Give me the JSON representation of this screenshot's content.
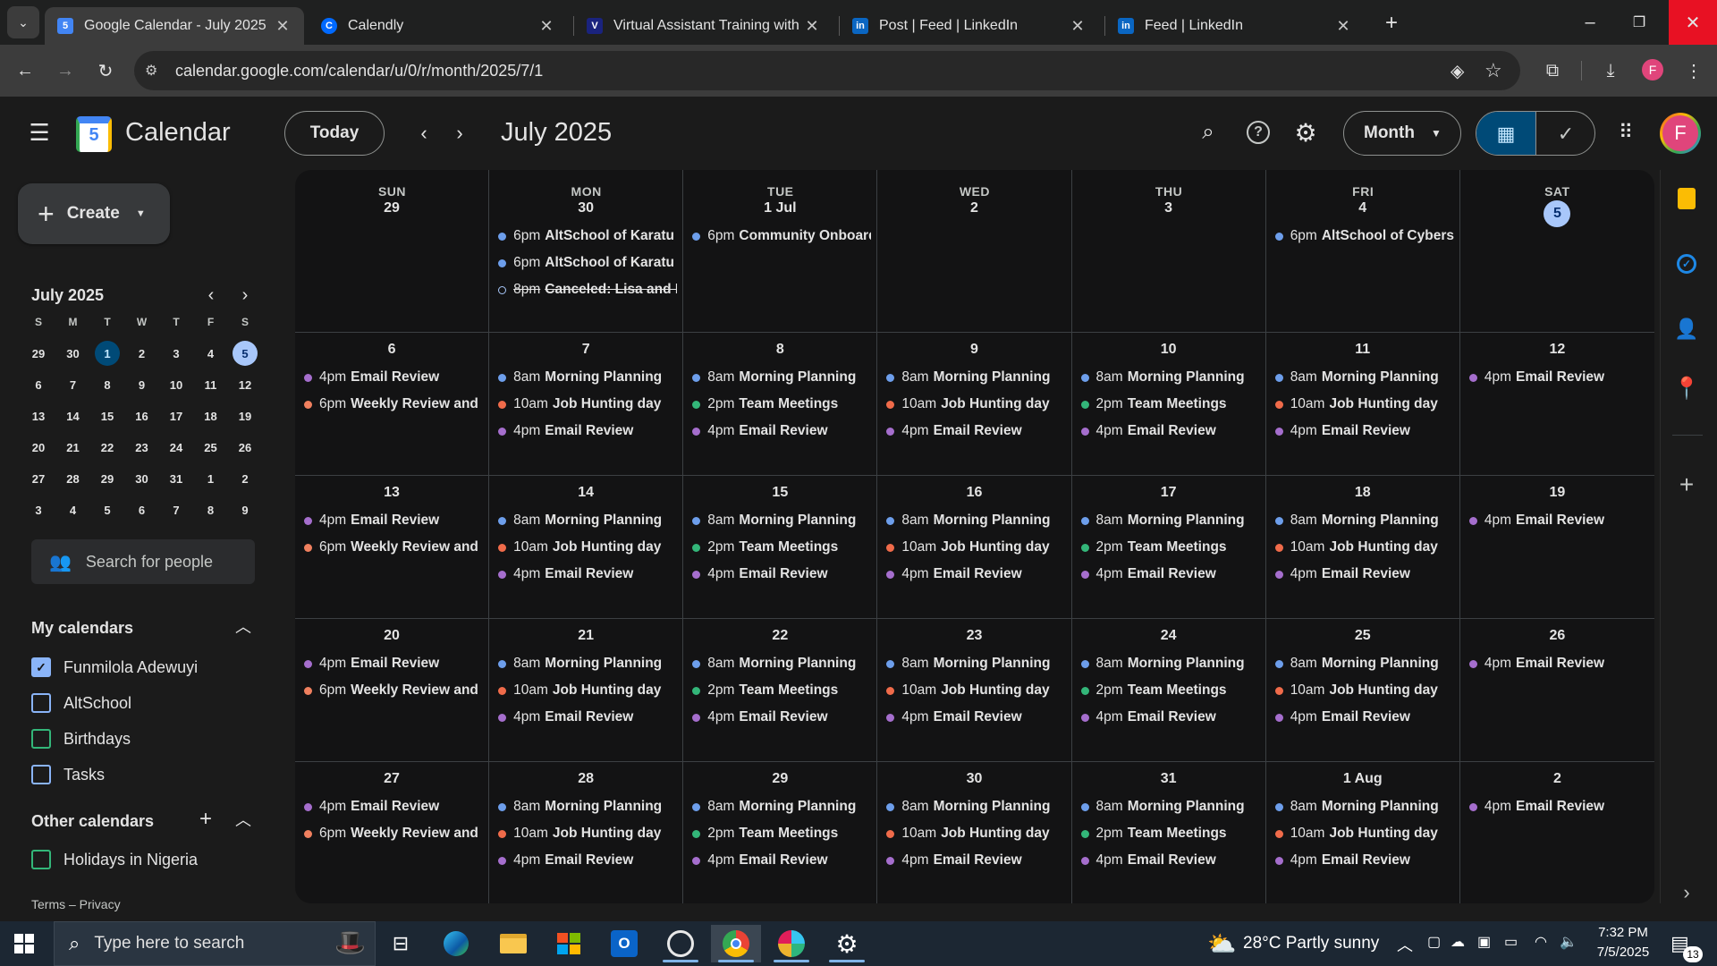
{
  "browser": {
    "tabs": [
      {
        "title": "Google Calendar - July 2025",
        "active": true
      },
      {
        "title": "Calendly",
        "active": false
      },
      {
        "title": "Virtual Assistant Training with V",
        "active": false
      },
      {
        "title": "Post | Feed | LinkedIn",
        "active": false
      },
      {
        "title": "Feed | LinkedIn",
        "active": false
      }
    ],
    "url": "calendar.google.com/calendar/u/0/r/month/2025/7/1",
    "profile_initial": "F"
  },
  "app": {
    "name": "Calendar",
    "logo_day": "5",
    "today_label": "Today",
    "title": "July 2025",
    "view_label": "Month",
    "avatar_initial": "F"
  },
  "sidebar": {
    "create_label": "Create",
    "mini": {
      "title": "July 2025",
      "weekdays": [
        "S",
        "M",
        "T",
        "W",
        "T",
        "F",
        "S"
      ],
      "weeks": [
        [
          "29",
          "30",
          "1",
          "2",
          "3",
          "4",
          "5"
        ],
        [
          "6",
          "7",
          "8",
          "9",
          "10",
          "11",
          "12"
        ],
        [
          "13",
          "14",
          "15",
          "16",
          "17",
          "18",
          "19"
        ],
        [
          "20",
          "21",
          "22",
          "23",
          "24",
          "25",
          "26"
        ],
        [
          "27",
          "28",
          "29",
          "30",
          "31",
          "1",
          "2"
        ],
        [
          "3",
          "4",
          "5",
          "6",
          "7",
          "8",
          "9"
        ]
      ]
    },
    "search_people": "Search for people",
    "my_calendars_title": "My calendars",
    "my_calendars": [
      {
        "label": "Funmilola Adewuyi",
        "checked": true
      },
      {
        "label": "AltSchool",
        "checked": false
      },
      {
        "label": "Birthdays",
        "checked": false
      },
      {
        "label": "Tasks",
        "checked": false
      }
    ],
    "other_calendars_title": "Other calendars",
    "other_calendars": [
      {
        "label": "Holidays in Nigeria",
        "checked": false
      }
    ],
    "footer": "Terms – Privacy"
  },
  "colors": {
    "purple": "#a56ecd",
    "orange": "#f0805f",
    "blue": "#6d9eeb",
    "green": "#33b679",
    "red": "#f06b4a",
    "teal": "#4db6ac"
  },
  "grid": {
    "weekdays": [
      "SUN",
      "MON",
      "TUE",
      "WED",
      "THU",
      "FRI",
      "SAT"
    ],
    "weeks": [
      [
        {
          "day": "29",
          "events": []
        },
        {
          "day": "30",
          "events": [
            {
              "time": "6pm",
              "title": "AltSchool of Karatu",
              "color": "blue"
            },
            {
              "time": "6pm",
              "title": "AltSchool of Karatu",
              "color": "blue"
            },
            {
              "time": "8pm",
              "title": "Canceled: Lisa and Fi",
              "color": "hollow",
              "struck": true
            }
          ]
        },
        {
          "day": "1 Jul",
          "events": [
            {
              "time": "6pm",
              "title": "Community Onboard",
              "color": "blue"
            }
          ]
        },
        {
          "day": "2",
          "events": []
        },
        {
          "day": "3",
          "events": []
        },
        {
          "day": "4",
          "events": [
            {
              "time": "6pm",
              "title": "AltSchool of Cybers",
              "color": "blue"
            }
          ]
        },
        {
          "day": "5",
          "today": true,
          "events": []
        }
      ],
      [
        {
          "day": "6",
          "events": [
            {
              "time": "4pm",
              "title": "Email Review",
              "color": "purple"
            },
            {
              "time": "6pm",
              "title": "Weekly Review and P",
              "color": "orange"
            }
          ]
        },
        {
          "day": "7",
          "events": [
            {
              "time": "8am",
              "title": "Morning Planning",
              "color": "blue"
            },
            {
              "time": "10am",
              "title": "Job Hunting day",
              "color": "red"
            },
            {
              "time": "4pm",
              "title": "Email Review",
              "color": "purple"
            }
          ]
        },
        {
          "day": "8",
          "events": [
            {
              "time": "8am",
              "title": "Morning Planning",
              "color": "blue"
            },
            {
              "time": "2pm",
              "title": "Team Meetings",
              "color": "green"
            },
            {
              "time": "4pm",
              "title": "Email Review",
              "color": "purple"
            }
          ]
        },
        {
          "day": "9",
          "events": [
            {
              "time": "8am",
              "title": "Morning Planning",
              "color": "blue"
            },
            {
              "time": "10am",
              "title": "Job Hunting day",
              "color": "red"
            },
            {
              "time": "4pm",
              "title": "Email Review",
              "color": "purple"
            }
          ]
        },
        {
          "day": "10",
          "events": [
            {
              "time": "8am",
              "title": "Morning Planning",
              "color": "blue"
            },
            {
              "time": "2pm",
              "title": "Team Meetings",
              "color": "green"
            },
            {
              "time": "4pm",
              "title": "Email Review",
              "color": "purple"
            }
          ]
        },
        {
          "day": "11",
          "events": [
            {
              "time": "8am",
              "title": "Morning Planning",
              "color": "blue"
            },
            {
              "time": "10am",
              "title": "Job Hunting day",
              "color": "red"
            },
            {
              "time": "4pm",
              "title": "Email Review",
              "color": "purple"
            }
          ]
        },
        {
          "day": "12",
          "events": [
            {
              "time": "4pm",
              "title": "Email Review",
              "color": "purple"
            }
          ]
        }
      ],
      [
        {
          "day": "13",
          "events": [
            {
              "time": "4pm",
              "title": "Email Review",
              "color": "purple"
            },
            {
              "time": "6pm",
              "title": "Weekly Review and P",
              "color": "orange"
            }
          ]
        },
        {
          "day": "14",
          "events": [
            {
              "time": "8am",
              "title": "Morning Planning",
              "color": "blue"
            },
            {
              "time": "10am",
              "title": "Job Hunting day",
              "color": "red"
            },
            {
              "time": "4pm",
              "title": "Email Review",
              "color": "purple"
            }
          ]
        },
        {
          "day": "15",
          "events": [
            {
              "time": "8am",
              "title": "Morning Planning",
              "color": "blue"
            },
            {
              "time": "2pm",
              "title": "Team Meetings",
              "color": "green"
            },
            {
              "time": "4pm",
              "title": "Email Review",
              "color": "purple"
            }
          ]
        },
        {
          "day": "16",
          "events": [
            {
              "time": "8am",
              "title": "Morning Planning",
              "color": "blue"
            },
            {
              "time": "10am",
              "title": "Job Hunting day",
              "color": "red"
            },
            {
              "time": "4pm",
              "title": "Email Review",
              "color": "purple"
            }
          ]
        },
        {
          "day": "17",
          "events": [
            {
              "time": "8am",
              "title": "Morning Planning",
              "color": "blue"
            },
            {
              "time": "2pm",
              "title": "Team Meetings",
              "color": "green"
            },
            {
              "time": "4pm",
              "title": "Email Review",
              "color": "purple"
            }
          ]
        },
        {
          "day": "18",
          "events": [
            {
              "time": "8am",
              "title": "Morning Planning",
              "color": "blue"
            },
            {
              "time": "10am",
              "title": "Job Hunting day",
              "color": "red"
            },
            {
              "time": "4pm",
              "title": "Email Review",
              "color": "purple"
            }
          ]
        },
        {
          "day": "19",
          "events": [
            {
              "time": "4pm",
              "title": "Email Review",
              "color": "purple"
            }
          ]
        }
      ],
      [
        {
          "day": "20",
          "events": [
            {
              "time": "4pm",
              "title": "Email Review",
              "color": "purple"
            },
            {
              "time": "6pm",
              "title": "Weekly Review and P",
              "color": "orange"
            }
          ]
        },
        {
          "day": "21",
          "events": [
            {
              "time": "8am",
              "title": "Morning Planning",
              "color": "blue"
            },
            {
              "time": "10am",
              "title": "Job Hunting day",
              "color": "red"
            },
            {
              "time": "4pm",
              "title": "Email Review",
              "color": "purple"
            }
          ]
        },
        {
          "day": "22",
          "events": [
            {
              "time": "8am",
              "title": "Morning Planning",
              "color": "blue"
            },
            {
              "time": "2pm",
              "title": "Team Meetings",
              "color": "green"
            },
            {
              "time": "4pm",
              "title": "Email Review",
              "color": "purple"
            }
          ]
        },
        {
          "day": "23",
          "events": [
            {
              "time": "8am",
              "title": "Morning Planning",
              "color": "blue"
            },
            {
              "time": "10am",
              "title": "Job Hunting day",
              "color": "red"
            },
            {
              "time": "4pm",
              "title": "Email Review",
              "color": "purple"
            }
          ]
        },
        {
          "day": "24",
          "events": [
            {
              "time": "8am",
              "title": "Morning Planning",
              "color": "blue"
            },
            {
              "time": "2pm",
              "title": "Team Meetings",
              "color": "green"
            },
            {
              "time": "4pm",
              "title": "Email Review",
              "color": "purple"
            }
          ]
        },
        {
          "day": "25",
          "events": [
            {
              "time": "8am",
              "title": "Morning Planning",
              "color": "blue"
            },
            {
              "time": "10am",
              "title": "Job Hunting day",
              "color": "red"
            },
            {
              "time": "4pm",
              "title": "Email Review",
              "color": "purple"
            }
          ]
        },
        {
          "day": "26",
          "events": [
            {
              "time": "4pm",
              "title": "Email Review",
              "color": "purple"
            }
          ]
        }
      ],
      [
        {
          "day": "27",
          "events": [
            {
              "time": "4pm",
              "title": "Email Review",
              "color": "purple"
            },
            {
              "time": "6pm",
              "title": "Weekly Review and P",
              "color": "orange"
            }
          ]
        },
        {
          "day": "28",
          "events": [
            {
              "time": "8am",
              "title": "Morning Planning",
              "color": "blue"
            },
            {
              "time": "10am",
              "title": "Job Hunting day",
              "color": "red"
            },
            {
              "time": "4pm",
              "title": "Email Review",
              "color": "purple"
            }
          ]
        },
        {
          "day": "29",
          "events": [
            {
              "time": "8am",
              "title": "Morning Planning",
              "color": "blue"
            },
            {
              "time": "2pm",
              "title": "Team Meetings",
              "color": "green"
            },
            {
              "time": "4pm",
              "title": "Email Review",
              "color": "purple"
            }
          ]
        },
        {
          "day": "30",
          "events": [
            {
              "time": "8am",
              "title": "Morning Planning",
              "color": "blue"
            },
            {
              "time": "10am",
              "title": "Job Hunting day",
              "color": "red"
            },
            {
              "time": "4pm",
              "title": "Email Review",
              "color": "purple"
            }
          ]
        },
        {
          "day": "31",
          "events": [
            {
              "time": "8am",
              "title": "Morning Planning",
              "color": "blue"
            },
            {
              "time": "2pm",
              "title": "Team Meetings",
              "color": "green"
            },
            {
              "time": "4pm",
              "title": "Email Review",
              "color": "purple"
            }
          ]
        },
        {
          "day": "1 Aug",
          "events": [
            {
              "time": "8am",
              "title": "Morning Planning",
              "color": "blue"
            },
            {
              "time": "10am",
              "title": "Job Hunting day",
              "color": "red"
            },
            {
              "time": "4pm",
              "title": "Email Review",
              "color": "purple"
            }
          ]
        },
        {
          "day": "2",
          "events": [
            {
              "time": "4pm",
              "title": "Email Review",
              "color": "purple"
            }
          ]
        }
      ]
    ]
  },
  "taskbar": {
    "search_placeholder": "Type here to search",
    "weather": "28°C  Partly sunny",
    "time": "7:32 PM",
    "date": "7/5/2025",
    "notification_count": "13"
  }
}
